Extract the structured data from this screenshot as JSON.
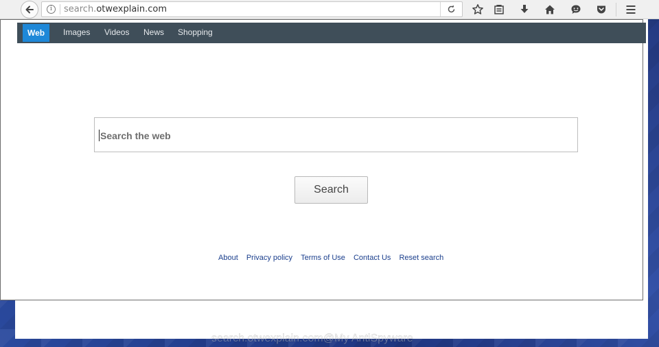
{
  "browser": {
    "url_prefix": "search.",
    "url_domain": "otwexplain.com"
  },
  "nav": {
    "items": [
      {
        "label": "Web",
        "active": true
      },
      {
        "label": "Images",
        "active": false
      },
      {
        "label": "Videos",
        "active": false
      },
      {
        "label": "News",
        "active": false
      },
      {
        "label": "Shopping",
        "active": false
      }
    ]
  },
  "search": {
    "placeholder": "Search the web",
    "button_label": "Search"
  },
  "footer": {
    "links": [
      "About",
      "Privacy policy",
      "Terms of Use",
      "Contact Us",
      "Reset search"
    ]
  },
  "watermark": "search.otwexplain.com@My AntiSpyware",
  "colors": {
    "nav_bg": "#3f4e59",
    "nav_active": "#1e88d8",
    "link": "#1a3e8c",
    "desktop": "#2b3f8f"
  }
}
